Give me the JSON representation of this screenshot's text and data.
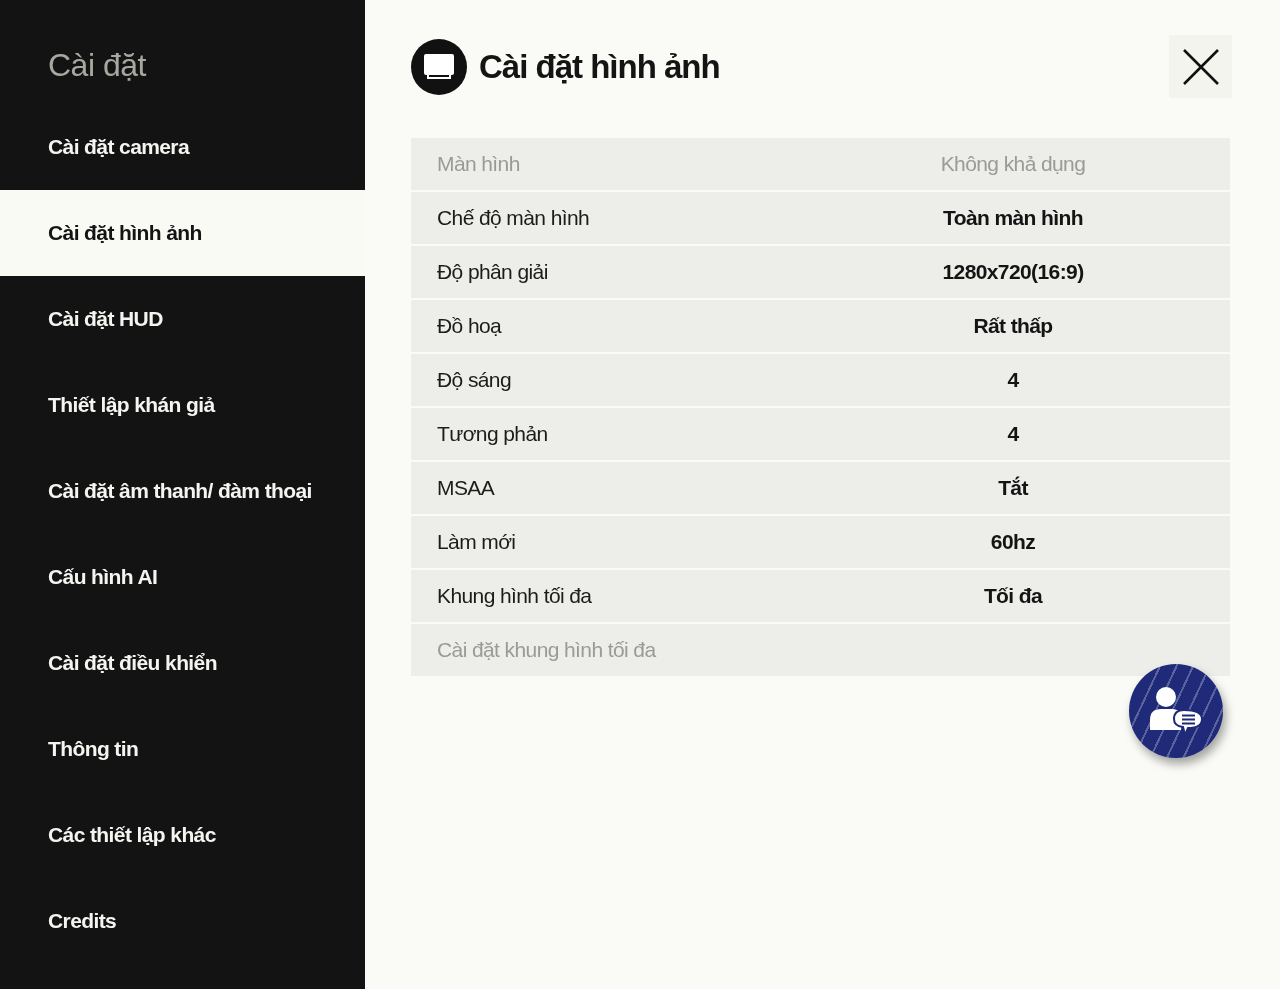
{
  "sidebar": {
    "title": "Cài đặt",
    "items": [
      {
        "label": "Cài đặt camera",
        "selected": false
      },
      {
        "label": "Cài đặt hình ảnh",
        "selected": true
      },
      {
        "label": "Cài đặt HUD",
        "selected": false
      },
      {
        "label": "Thiết lập khán giả",
        "selected": false
      },
      {
        "label": "Cài đặt âm thanh/ đàm thoại",
        "selected": false
      },
      {
        "label": "Cấu hình AI",
        "selected": false
      },
      {
        "label": "Cài đặt điều khiển",
        "selected": false
      },
      {
        "label": "Thông tin",
        "selected": false
      },
      {
        "label": "Các thiết lập khác",
        "selected": false
      },
      {
        "label": "Credits",
        "selected": false
      }
    ]
  },
  "panel": {
    "title": "Cài đặt hình ảnh",
    "settings": [
      {
        "label": "Màn hình",
        "value": "Không khả dụng",
        "disabled": true
      },
      {
        "label": "Chế độ màn hình",
        "value": "Toàn màn hình",
        "disabled": false
      },
      {
        "label": "Độ phân giải",
        "value": "1280x720(16:9)",
        "disabled": false
      },
      {
        "label": "Đồ hoạ",
        "value": "Rất thấp",
        "disabled": false
      },
      {
        "label": "Độ sáng",
        "value": "4",
        "disabled": false
      },
      {
        "label": "Tương phản",
        "value": "4",
        "disabled": false
      },
      {
        "label": "MSAA",
        "value": "Tắt",
        "disabled": false
      },
      {
        "label": "Làm mới",
        "value": "60hz",
        "disabled": false
      },
      {
        "label": "Khung hình tối đa",
        "value": "Tối đa",
        "disabled": false
      },
      {
        "label": "Cài đặt khung hình tối đa",
        "disabled": true
      }
    ]
  }
}
